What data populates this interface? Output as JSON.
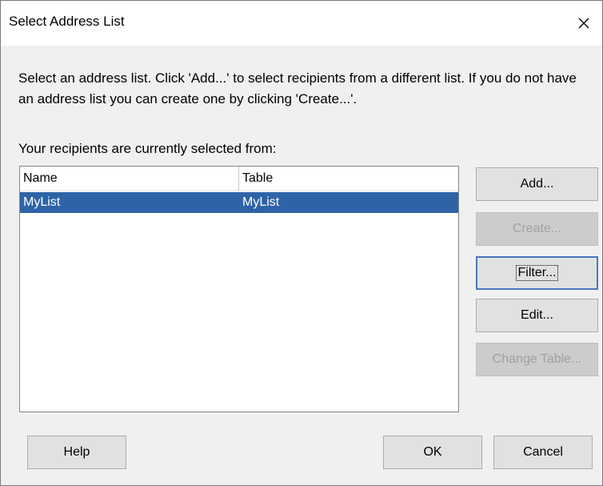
{
  "dialog": {
    "title": "Select Address List"
  },
  "description": "Select an address list. Click 'Add...' to select recipients from a different list. If you do not have an address list you can create one by clicking 'Create...'.",
  "current_label": "Your recipients are currently selected from:",
  "list": {
    "columns": [
      "Name",
      "Table"
    ],
    "rows": [
      {
        "name": "MyList",
        "table": "MyList",
        "selected": true
      }
    ]
  },
  "buttons": {
    "add": "Add...",
    "create": "Create...",
    "filter": "Filter...",
    "edit": "Edit...",
    "change_table": "Change Table...",
    "help": "Help",
    "ok": "OK",
    "cancel": "Cancel"
  },
  "colors": {
    "selection": "#2f63a8",
    "dialog_bg": "#f0f0f0",
    "button_bg": "#e1e1e1",
    "focus_border": "#4a78b8"
  },
  "icons": {
    "close": "close-icon"
  }
}
